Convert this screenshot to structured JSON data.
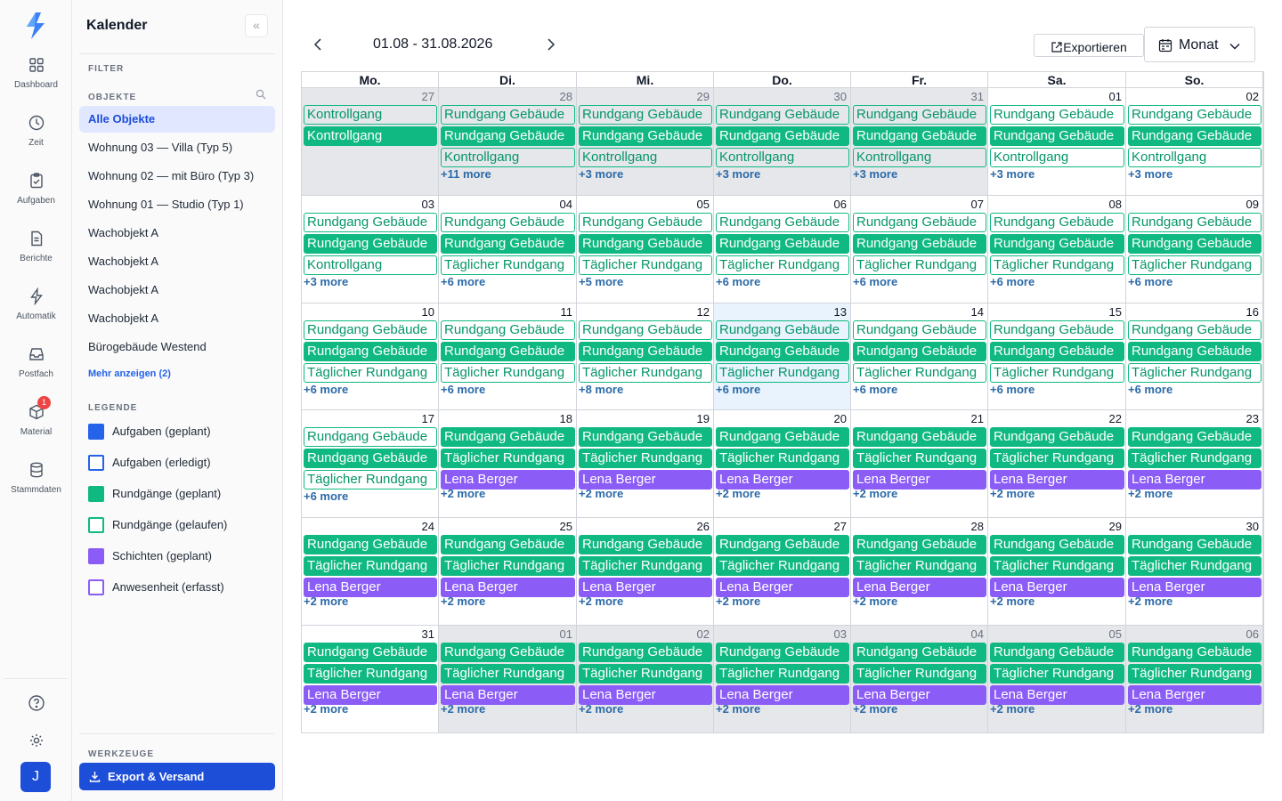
{
  "rail": {
    "items": [
      {
        "label": "Dashboard",
        "icon": "dashboard-icon"
      },
      {
        "label": "Zeit",
        "icon": "clock-icon"
      },
      {
        "label": "Aufgaben",
        "icon": "clipboard-icon"
      },
      {
        "label": "Berichte",
        "icon": "document-icon"
      },
      {
        "label": "Automatik",
        "icon": "bolt-icon"
      },
      {
        "label": "Postfach",
        "icon": "inbox-icon"
      },
      {
        "label": "Material",
        "icon": "box-icon",
        "badge": "1"
      },
      {
        "label": "Stammdaten",
        "icon": "database-icon"
      }
    ],
    "avatar": "J"
  },
  "sidebar": {
    "title": "Kalender",
    "filter_label": "FILTER",
    "objects_label": "OBJEKTE",
    "objects": [
      "Alle Objekte",
      "Wohnung 03 — Villa (Typ 5)",
      "Wohnung 02 — mit Büro (Typ 3)",
      "Wohnung 01 — Studio (Typ 1)",
      "Wachobjekt A",
      "Wachobjekt A",
      "Wachobjekt A",
      "Wachobjekt A",
      "Bürogebäude Westend"
    ],
    "show_more": "Mehr anzeigen (2)",
    "legend_label": "LEGENDE",
    "legend": [
      {
        "label": "Aufgaben (geplant)",
        "color": "#2563eb",
        "style": "solid"
      },
      {
        "label": "Aufgaben (erledigt)",
        "color": "#2563eb",
        "style": "outline"
      },
      {
        "label": "Rundgänge (geplant)",
        "color": "#10b981",
        "style": "solid"
      },
      {
        "label": "Rundgänge (gelaufen)",
        "color": "#10b981",
        "style": "outline"
      },
      {
        "label": "Schichten (geplant)",
        "color": "#8b5cf6",
        "style": "solid"
      },
      {
        "label": "Anwesenheit (erfasst)",
        "color": "#8b5cf6",
        "style": "outline"
      }
    ],
    "tools_label": "WERKZEUGE",
    "export_button": "Export & Versand"
  },
  "toolbar": {
    "range": "01.08 - 31.08.2026",
    "export": "Exportieren",
    "view": "Monat"
  },
  "calendar": {
    "weekdays": [
      "Mo.",
      "Di.",
      "Mi.",
      "Do.",
      "Fr.",
      "Sa.",
      "So."
    ],
    "weeks": [
      [
        {
          "day": "27",
          "other": true,
          "events": [
            [
              "o",
              "Kontrollgang"
            ],
            [
              "s",
              "Kontrollgang"
            ]
          ],
          "more": ""
        },
        {
          "day": "28",
          "other": true,
          "events": [
            [
              "o",
              "Rundgang Gebäude"
            ],
            [
              "s",
              "Rundgang Gebäude"
            ],
            [
              "o",
              "Kontrollgang"
            ]
          ],
          "more": "+11 more"
        },
        {
          "day": "29",
          "other": true,
          "events": [
            [
              "o",
              "Rundgang Gebäude"
            ],
            [
              "s",
              "Rundgang Gebäude"
            ],
            [
              "o",
              "Kontrollgang"
            ]
          ],
          "more": "+3 more"
        },
        {
          "day": "30",
          "other": true,
          "events": [
            [
              "o",
              "Rundgang Gebäude"
            ],
            [
              "s",
              "Rundgang Gebäude"
            ],
            [
              "o",
              "Kontrollgang"
            ]
          ],
          "more": "+3 more"
        },
        {
          "day": "31",
          "other": true,
          "events": [
            [
              "o",
              "Rundgang Gebäude"
            ],
            [
              "s",
              "Rundgang Gebäude"
            ],
            [
              "o",
              "Kontrollgang"
            ]
          ],
          "more": "+3 more"
        },
        {
          "day": "01",
          "events": [
            [
              "o",
              "Rundgang Gebäude"
            ],
            [
              "s",
              "Rundgang Gebäude"
            ],
            [
              "o",
              "Kontrollgang"
            ]
          ],
          "more": "+3 more"
        },
        {
          "day": "02",
          "events": [
            [
              "o",
              "Rundgang Gebäude"
            ],
            [
              "s",
              "Rundgang Gebäude"
            ],
            [
              "o",
              "Kontrollgang"
            ]
          ],
          "more": "+3 more"
        }
      ],
      [
        {
          "day": "03",
          "events": [
            [
              "o",
              "Rundgang Gebäude"
            ],
            [
              "s",
              "Rundgang Gebäude"
            ],
            [
              "o",
              "Kontrollgang"
            ]
          ],
          "more": "+3 more"
        },
        {
          "day": "04",
          "events": [
            [
              "o",
              "Rundgang Gebäude"
            ],
            [
              "s",
              "Rundgang Gebäude"
            ],
            [
              "o",
              "Täglicher Rundgang"
            ]
          ],
          "more": "+6 more"
        },
        {
          "day": "05",
          "events": [
            [
              "o",
              "Rundgang Gebäude"
            ],
            [
              "s",
              "Rundgang Gebäude"
            ],
            [
              "o",
              "Täglicher Rundgang"
            ]
          ],
          "more": "+5 more"
        },
        {
          "day": "06",
          "events": [
            [
              "o",
              "Rundgang Gebäude"
            ],
            [
              "s",
              "Rundgang Gebäude"
            ],
            [
              "o",
              "Täglicher Rundgang"
            ]
          ],
          "more": "+6 more"
        },
        {
          "day": "07",
          "events": [
            [
              "o",
              "Rundgang Gebäude"
            ],
            [
              "s",
              "Rundgang Gebäude"
            ],
            [
              "o",
              "Täglicher Rundgang"
            ]
          ],
          "more": "+6 more"
        },
        {
          "day": "08",
          "events": [
            [
              "o",
              "Rundgang Gebäude"
            ],
            [
              "s",
              "Rundgang Gebäude"
            ],
            [
              "o",
              "Täglicher Rundgang"
            ]
          ],
          "more": "+6 more"
        },
        {
          "day": "09",
          "events": [
            [
              "o",
              "Rundgang Gebäude"
            ],
            [
              "s",
              "Rundgang Gebäude"
            ],
            [
              "o",
              "Täglicher Rundgang"
            ]
          ],
          "more": "+6 more"
        }
      ],
      [
        {
          "day": "10",
          "events": [
            [
              "o",
              "Rundgang Gebäude"
            ],
            [
              "s",
              "Rundgang Gebäude"
            ],
            [
              "o",
              "Täglicher Rundgang"
            ]
          ],
          "more": "+6 more"
        },
        {
          "day": "11",
          "events": [
            [
              "o",
              "Rundgang Gebäude"
            ],
            [
              "s",
              "Rundgang Gebäude"
            ],
            [
              "o",
              "Täglicher Rundgang"
            ]
          ],
          "more": "+6 more"
        },
        {
          "day": "12",
          "events": [
            [
              "o",
              "Rundgang Gebäude"
            ],
            [
              "s",
              "Rundgang Gebäude"
            ],
            [
              "o",
              "Täglicher Rundgang"
            ]
          ],
          "more": "+8 more"
        },
        {
          "day": "13",
          "today": true,
          "events": [
            [
              "o",
              "Rundgang Gebäude"
            ],
            [
              "s",
              "Rundgang Gebäude"
            ],
            [
              "o",
              "Täglicher Rundgang"
            ]
          ],
          "more": "+6 more"
        },
        {
          "day": "14",
          "events": [
            [
              "o",
              "Rundgang Gebäude"
            ],
            [
              "s",
              "Rundgang Gebäude"
            ],
            [
              "o",
              "Täglicher Rundgang"
            ]
          ],
          "more": "+6 more"
        },
        {
          "day": "15",
          "events": [
            [
              "o",
              "Rundgang Gebäude"
            ],
            [
              "s",
              "Rundgang Gebäude"
            ],
            [
              "o",
              "Täglicher Rundgang"
            ]
          ],
          "more": "+6 more"
        },
        {
          "day": "16",
          "events": [
            [
              "o",
              "Rundgang Gebäude"
            ],
            [
              "s",
              "Rundgang Gebäude"
            ],
            [
              "o",
              "Täglicher Rundgang"
            ]
          ],
          "more": "+6 more"
        }
      ],
      [
        {
          "day": "17",
          "events": [
            [
              "o",
              "Rundgang Gebäude"
            ],
            [
              "s",
              "Rundgang Gebäude"
            ],
            [
              "o",
              "Täglicher Rundgang"
            ]
          ],
          "more": "+6 more"
        },
        {
          "day": "18",
          "events": [
            [
              "s",
              "Rundgang Gebäude"
            ],
            [
              "s",
              "Täglicher Rundgang"
            ],
            [
              "p",
              "Lena Berger"
            ]
          ],
          "more": "+2 more"
        },
        {
          "day": "19",
          "events": [
            [
              "s",
              "Rundgang Gebäude"
            ],
            [
              "s",
              "Täglicher Rundgang"
            ],
            [
              "p",
              "Lena Berger"
            ]
          ],
          "more": "+2 more"
        },
        {
          "day": "20",
          "events": [
            [
              "s",
              "Rundgang Gebäude"
            ],
            [
              "s",
              "Täglicher Rundgang"
            ],
            [
              "p",
              "Lena Berger"
            ]
          ],
          "more": "+2 more"
        },
        {
          "day": "21",
          "events": [
            [
              "s",
              "Rundgang Gebäude"
            ],
            [
              "s",
              "Täglicher Rundgang"
            ],
            [
              "p",
              "Lena Berger"
            ]
          ],
          "more": "+2 more"
        },
        {
          "day": "22",
          "events": [
            [
              "s",
              "Rundgang Gebäude"
            ],
            [
              "s",
              "Täglicher Rundgang"
            ],
            [
              "p",
              "Lena Berger"
            ]
          ],
          "more": "+2 more"
        },
        {
          "day": "23",
          "events": [
            [
              "s",
              "Rundgang Gebäude"
            ],
            [
              "s",
              "Täglicher Rundgang"
            ],
            [
              "p",
              "Lena Berger"
            ]
          ],
          "more": "+2 more"
        }
      ],
      [
        {
          "day": "24",
          "events": [
            [
              "s",
              "Rundgang Gebäude"
            ],
            [
              "s",
              "Täglicher Rundgang"
            ],
            [
              "p",
              "Lena Berger"
            ]
          ],
          "more": "+2 more"
        },
        {
          "day": "25",
          "events": [
            [
              "s",
              "Rundgang Gebäude"
            ],
            [
              "s",
              "Täglicher Rundgang"
            ],
            [
              "p",
              "Lena Berger"
            ]
          ],
          "more": "+2 more"
        },
        {
          "day": "26",
          "events": [
            [
              "s",
              "Rundgang Gebäude"
            ],
            [
              "s",
              "Täglicher Rundgang"
            ],
            [
              "p",
              "Lena Berger"
            ]
          ],
          "more": "+2 more"
        },
        {
          "day": "27",
          "events": [
            [
              "s",
              "Rundgang Gebäude"
            ],
            [
              "s",
              "Täglicher Rundgang"
            ],
            [
              "p",
              "Lena Berger"
            ]
          ],
          "more": "+2 more"
        },
        {
          "day": "28",
          "events": [
            [
              "s",
              "Rundgang Gebäude"
            ],
            [
              "s",
              "Täglicher Rundgang"
            ],
            [
              "p",
              "Lena Berger"
            ]
          ],
          "more": "+2 more"
        },
        {
          "day": "29",
          "events": [
            [
              "s",
              "Rundgang Gebäude"
            ],
            [
              "s",
              "Täglicher Rundgang"
            ],
            [
              "p",
              "Lena Berger"
            ]
          ],
          "more": "+2 more"
        },
        {
          "day": "30",
          "events": [
            [
              "s",
              "Rundgang Gebäude"
            ],
            [
              "s",
              "Täglicher Rundgang"
            ],
            [
              "p",
              "Lena Berger"
            ]
          ],
          "more": "+2 more"
        }
      ],
      [
        {
          "day": "31",
          "events": [
            [
              "s",
              "Rundgang Gebäude"
            ],
            [
              "s",
              "Täglicher Rundgang"
            ],
            [
              "p",
              "Lena Berger"
            ]
          ],
          "more": "+2 more"
        },
        {
          "day": "01",
          "other": true,
          "events": [
            [
              "s",
              "Rundgang Gebäude"
            ],
            [
              "s",
              "Täglicher Rundgang"
            ],
            [
              "p",
              "Lena Berger"
            ]
          ],
          "more": "+2 more"
        },
        {
          "day": "02",
          "other": true,
          "events": [
            [
              "s",
              "Rundgang Gebäude"
            ],
            [
              "s",
              "Täglicher Rundgang"
            ],
            [
              "p",
              "Lena Berger"
            ]
          ],
          "more": "+2 more"
        },
        {
          "day": "03",
          "other": true,
          "events": [
            [
              "s",
              "Rundgang Gebäude"
            ],
            [
              "s",
              "Täglicher Rundgang"
            ],
            [
              "p",
              "Lena Berger"
            ]
          ],
          "more": "+2 more"
        },
        {
          "day": "04",
          "other": true,
          "events": [
            [
              "s",
              "Rundgang Gebäude"
            ],
            [
              "s",
              "Täglicher Rundgang"
            ],
            [
              "p",
              "Lena Berger"
            ]
          ],
          "more": "+2 more"
        },
        {
          "day": "05",
          "other": true,
          "events": [
            [
              "s",
              "Rundgang Gebäude"
            ],
            [
              "s",
              "Täglicher Rundgang"
            ],
            [
              "p",
              "Lena Berger"
            ]
          ],
          "more": "+2 more"
        },
        {
          "day": "06",
          "other": true,
          "events": [
            [
              "s",
              "Rundgang Gebäude"
            ],
            [
              "s",
              "Täglicher Rundgang"
            ],
            [
              "p",
              "Lena Berger"
            ]
          ],
          "more": "+2 more"
        }
      ]
    ]
  }
}
